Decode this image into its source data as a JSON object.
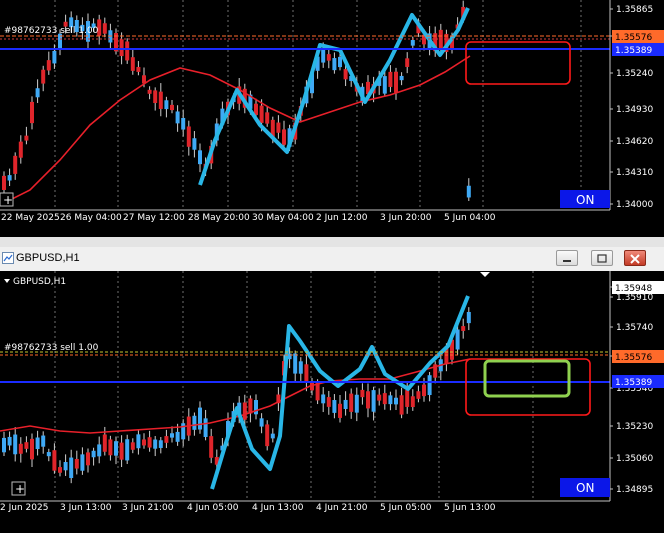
{
  "top_chart": {
    "order_label": "#98762733 sell 1.00",
    "price_labels": [
      "1.35865",
      "1.35576",
      "1.35240",
      "1.34930",
      "1.34620",
      "1.34310",
      "1.34000"
    ],
    "current_price_box": "1.35576",
    "blue_line_box": "1.35389",
    "time_labels": [
      "22 May 2025",
      "26 May 04:00",
      "27 May 12:00",
      "28 May 20:00",
      "30 May 04:00",
      "2 Jun 12:00",
      "3 Jun 20:00",
      "5 Jun 04:00"
    ],
    "on_button": "ON",
    "colors": {
      "bull": "#3fa9f5",
      "bear": "#e0252b",
      "ma": "#e8202a",
      "zigzag": "#29b6e6",
      "level": "#ff6a2a",
      "blue_line": "#1a2bff"
    }
  },
  "bottom_window": {
    "title": "GBPUSD,H1",
    "chart_symbol": "GBPUSD,H1",
    "order_label": "#98762733 sell 1.00",
    "price_labels": [
      "1.35948",
      "1.35910",
      "1.35740",
      "1.35576",
      "1.35540",
      "1.35230",
      "1.35060",
      "1.34895"
    ],
    "current_price_box": "1.35948",
    "level_box": "1.35576",
    "blue_line_box": "1.35389",
    "time_labels": [
      "2 Jun 2025",
      "3 Jun 13:00",
      "3 Jun 21:00",
      "4 Jun 05:00",
      "4 Jun 13:00",
      "4 Jun 21:00",
      "5 Jun 05:00",
      "5 Jun 13:00"
    ],
    "on_button": "ON",
    "highlight_color": "#8fd14f"
  }
}
